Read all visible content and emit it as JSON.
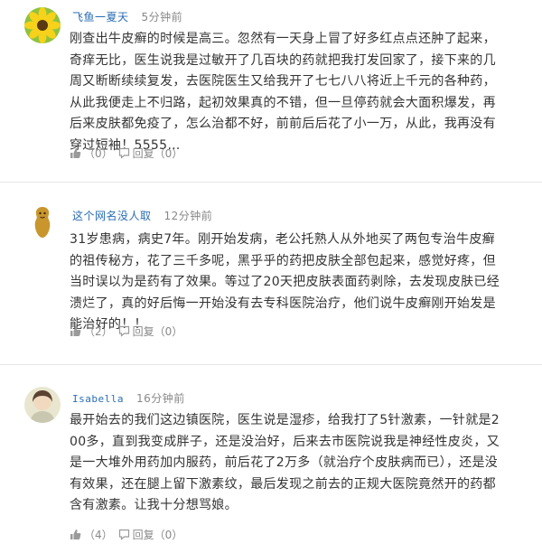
{
  "comments": [
    {
      "username": "飞鱼一夏天",
      "time": "5分钟前",
      "text": "刚查出牛皮癣的时候是高三。忽然有一天身上冒了好多红点点还肿了起来，奇痒无比，医生说我是过敏开了几百块的药就把我打发回家了，接下来的几周又断断续续复发，去医院医生又给我开了七七八八将近上千元的各种药，从此我便走上不归路，起初效果真的不错，但一旦停药就会大面积爆发，再后来皮肤都免疫了，怎么治都不好，前前后后花了小一万，从此，我再没有穿过短袖！5555…",
      "like_count": "（0）",
      "reply_label": "回复（0）",
      "avatar_icon": "sunflower-avatar-icon"
    },
    {
      "username": "这个网名没人取",
      "time": "12分钟前",
      "text": "31岁患病，病史7年。刚开始发病，老公托熟人从外地买了两包专治牛皮癣的祖传秘方，花了三千多呢，黑乎乎的药把皮肤全部包起来，感觉好疼，但当时误以为是药有了效果。等过了20天把皮肤表面药剥除，去发现皮肤已经溃烂了，真的好后悔一开始没有去专科医院治疗，他们说牛皮癣刚开始发是能治好的！！",
      "like_count": "（2）",
      "reply_label": "回复（0）",
      "avatar_icon": "peanut-avatar-icon"
    },
    {
      "username": "Isabella",
      "time": "16分钟前",
      "text": "最开始去的我们这边镇医院，医生说是湿疹，给我打了5针激素，一针就是200多，直到我变成胖子，还是没治好，后来去市医院说我是神经性皮炎，又是一大堆外用药加内服药，前后花了2万多（就治疗个皮肤病而已），还是没有效果，还在腿上留下激素纹，最后发现之前去的正规大医院竟然开的药都含有激素。让我十分想骂娘。",
      "like_count": "（4）",
      "reply_label": "回复（0）",
      "avatar_icon": "girl-avatar-icon"
    }
  ],
  "colors": {
    "username": "#2a6db5",
    "meta": "#888888",
    "text": "#333333",
    "divider": "#e6e6e6"
  }
}
